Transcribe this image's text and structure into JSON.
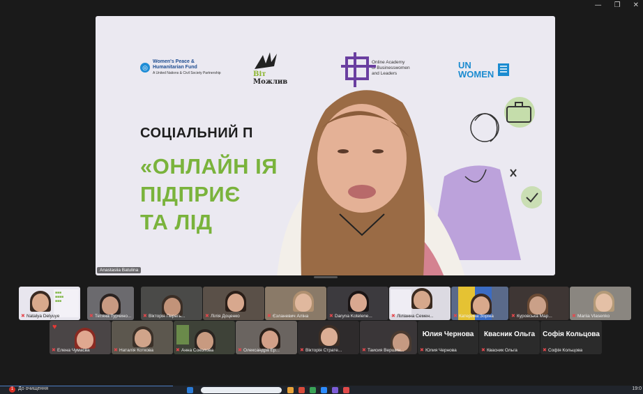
{
  "window": {
    "minimize_icon": "—",
    "restore_icon": "❐",
    "close_icon": "✕"
  },
  "slide": {
    "logos": {
      "wph_title_1": "Women's Peace &",
      "wph_title_2": "Humanitarian Fund",
      "wph_sub": "A United Nations & Civil Society Partnership",
      "bird_text": "Можлив",
      "bird_accent": "Віт",
      "academy_1": "Online Academy",
      "academy_2": "of Businesswomen",
      "academy_3": "and Leaders",
      "unwomen_1": "UN",
      "unwomen_2": "WOMEN"
    },
    "subtitle": "СОЦІАЛЬНИЙ П",
    "title_line_1": "«ОНЛАЙН          ІЯ",
    "title_line_2": "ПІДПРИЄ",
    "title_line_3": "ТА ЛІД"
  },
  "speaker": {
    "name": "Anastasiia Batulina"
  },
  "participants_row1": [
    {
      "name": "Natalya Delyuye",
      "muted": true
    },
    {
      "name": "Тетяна Турчино...",
      "muted": true
    },
    {
      "name": "Вікторія Перегь...",
      "muted": true
    },
    {
      "name": "Лілія Доценко",
      "muted": true
    },
    {
      "name": "Єзланевич Аліна",
      "muted": true
    },
    {
      "name": "Daryna Kotelene...",
      "muted": true
    },
    {
      "name": "Ліліанна Семен...",
      "muted": true
    },
    {
      "name": "Катерина Зоріна",
      "muted": true
    },
    {
      "name": "Куровська Мар...",
      "muted": true
    },
    {
      "name": "Mariia Vlasenko",
      "muted": true
    }
  ],
  "participants_row2": [
    {
      "name": "Елена Чумасва",
      "muted": true
    },
    {
      "name": "Наталія Коткова",
      "muted": true
    },
    {
      "name": "Анна Соколова",
      "muted": true
    },
    {
      "name": "Олександра Ер...",
      "muted": true
    },
    {
      "name": "Вікторія Страте...",
      "muted": true
    },
    {
      "name": "Таисия Вершин...",
      "muted": true
    },
    {
      "name": "Юлия Чернова",
      "display": "Юлия Чернова",
      "muted": true
    },
    {
      "name": "Квасник Ольга",
      "display": "Квасник Ольга",
      "muted": true
    },
    {
      "name": "Софія Кольцова",
      "display": "Софія Кольцова",
      "muted": true
    }
  ],
  "taskbar": {
    "badge": "1",
    "notification": "До очищення",
    "clock": "19:0"
  }
}
